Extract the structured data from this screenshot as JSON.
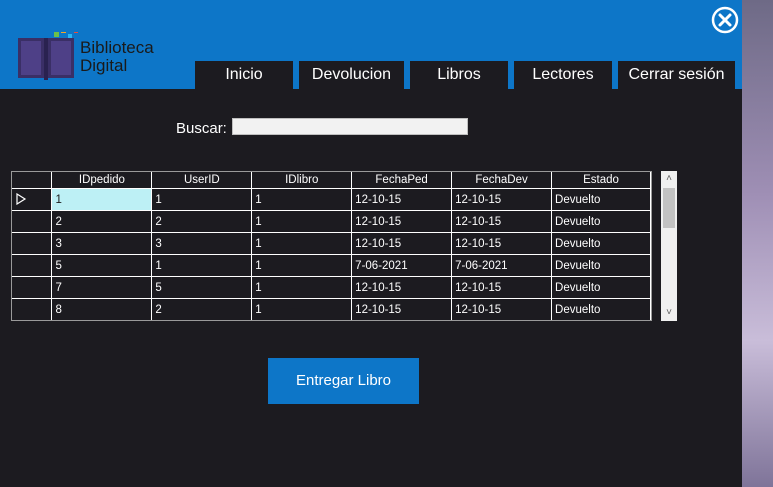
{
  "app": {
    "logo_line1": "Biblioteca",
    "logo_line2": "Digital"
  },
  "nav": {
    "tabs": [
      {
        "label": "Inicio"
      },
      {
        "label": "Devolucion"
      },
      {
        "label": "Libros"
      },
      {
        "label": "Lectores"
      },
      {
        "label": "Cerrar sesión"
      }
    ]
  },
  "search": {
    "label": "Buscar:",
    "value": "",
    "placeholder": ""
  },
  "table": {
    "columns": [
      "IDpedido",
      "UserID",
      "IDlibro",
      "FechaPed",
      "FechaDev",
      "Estado"
    ],
    "rows": [
      [
        "1",
        "1",
        "1",
        "12-10-15",
        "12-10-15",
        "Devuelto"
      ],
      [
        "2",
        "2",
        "1",
        "12-10-15",
        "12-10-15",
        "Devuelto"
      ],
      [
        "3",
        "3",
        "1",
        "12-10-15",
        "12-10-15",
        "Devuelto"
      ],
      [
        "5",
        "1",
        "1",
        "7-06-2021",
        "7-06-2021",
        "Devuelto"
      ],
      [
        "7",
        "5",
        "1",
        "12-10-15",
        "12-10-15",
        "Devuelto"
      ],
      [
        "8",
        "2",
        "1",
        "12-10-15",
        "12-10-15",
        "Devuelto"
      ]
    ]
  },
  "actions": {
    "deliver_label": "Entregar Libro"
  },
  "colors": {
    "accent": "#0d76c8",
    "window_bg": "#1c1b20",
    "selected_cell": "#bdf0f5"
  },
  "icons": {
    "close": "close-circle-icon",
    "logo": "book-logo-icon",
    "row_pointer": "triangle-right-icon"
  }
}
